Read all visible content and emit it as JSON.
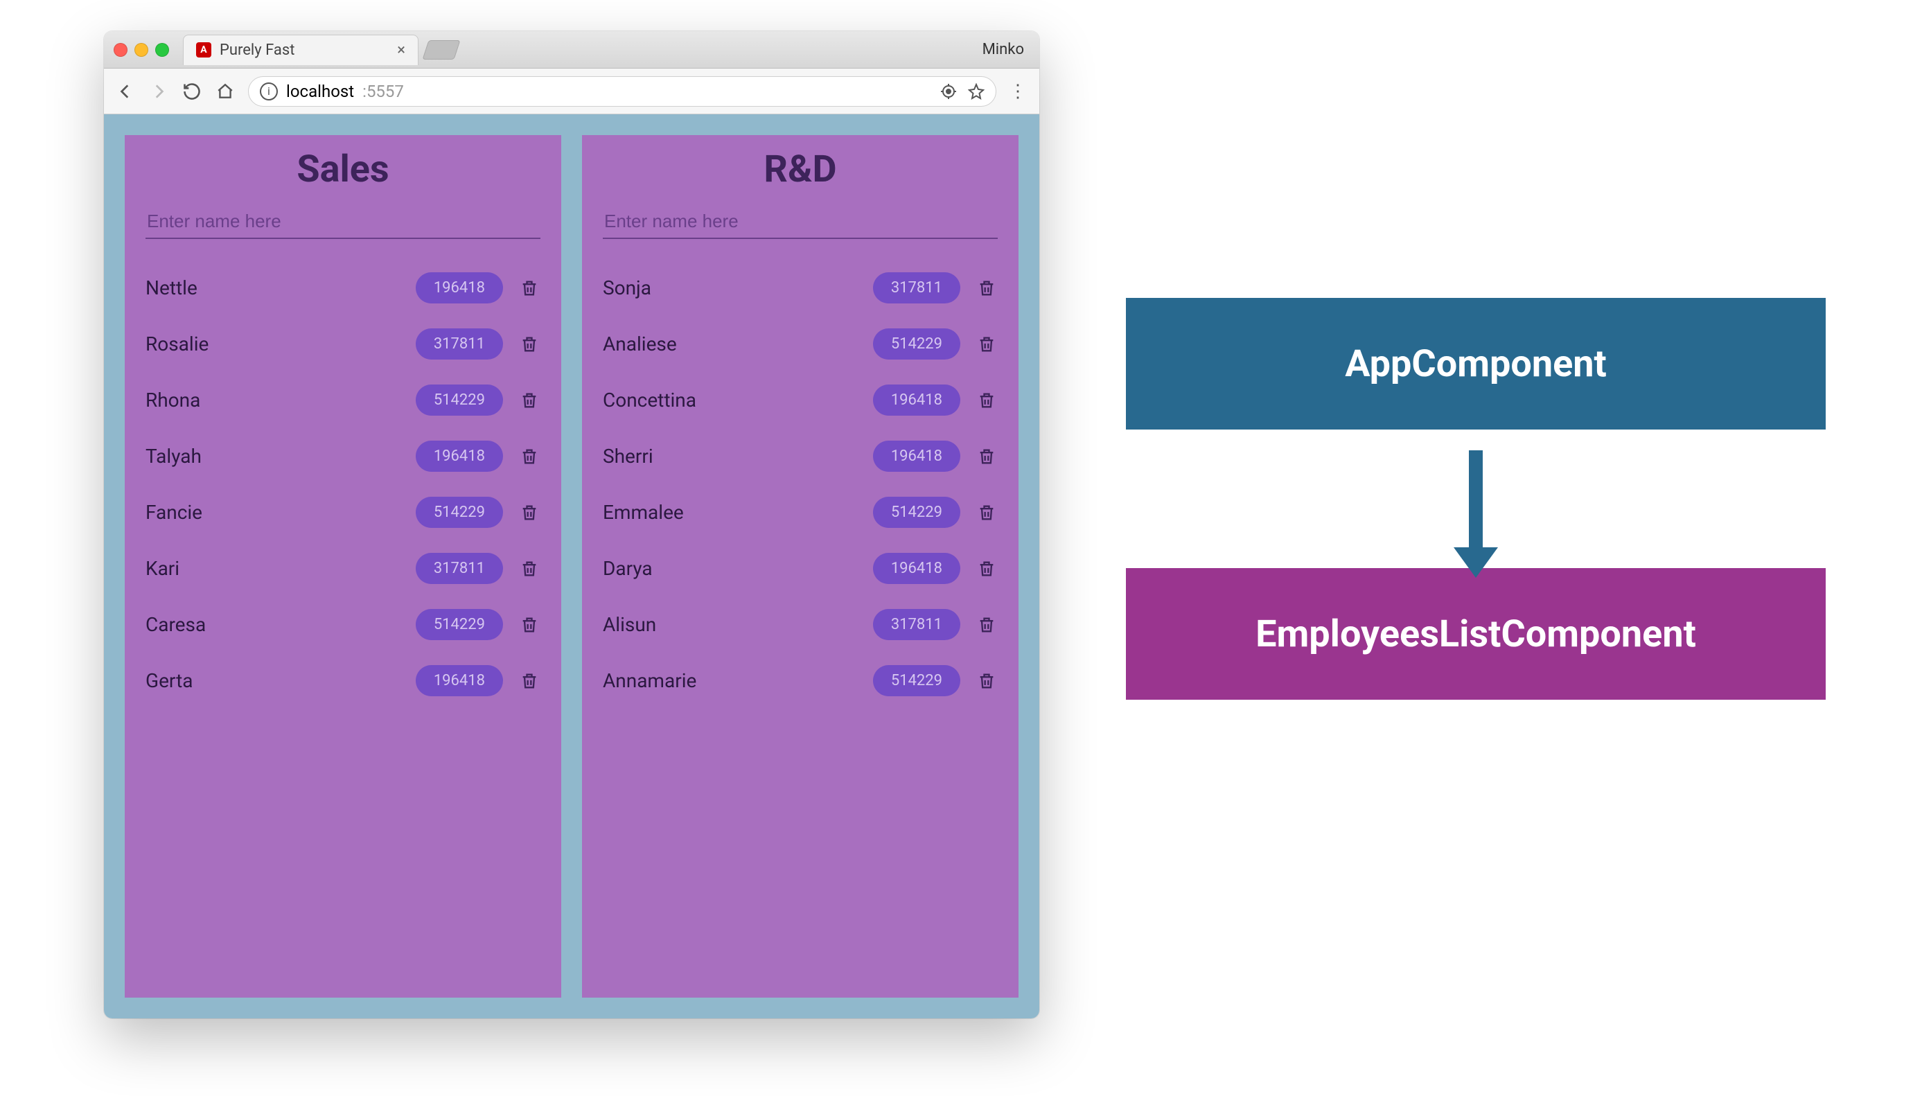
{
  "browser": {
    "tab_title": "Purely Fast",
    "profile_name": "Minko",
    "address_host": "localhost",
    "address_port": ":5557"
  },
  "app": {
    "panels": [
      {
        "title": "Sales",
        "placeholder": "Enter name here",
        "rows": [
          {
            "name": "Nettle",
            "value": "196418"
          },
          {
            "name": "Rosalie",
            "value": "317811"
          },
          {
            "name": "Rhona",
            "value": "514229"
          },
          {
            "name": "Talyah",
            "value": "196418"
          },
          {
            "name": "Fancie",
            "value": "514229"
          },
          {
            "name": "Kari",
            "value": "317811"
          },
          {
            "name": "Caresa",
            "value": "514229"
          },
          {
            "name": "Gerta",
            "value": "196418"
          }
        ]
      },
      {
        "title": "R&D",
        "placeholder": "Enter name here",
        "rows": [
          {
            "name": "Sonja",
            "value": "317811"
          },
          {
            "name": "Analiese",
            "value": "514229"
          },
          {
            "name": "Concettina",
            "value": "196418"
          },
          {
            "name": "Sherri",
            "value": "196418"
          },
          {
            "name": "Emmalee",
            "value": "514229"
          },
          {
            "name": "Darya",
            "value": "196418"
          },
          {
            "name": "Alisun",
            "value": "317811"
          },
          {
            "name": "Annamarie",
            "value": "514229"
          }
        ]
      }
    ]
  },
  "diagram": {
    "nodes": [
      {
        "label": "AppComponent"
      },
      {
        "label": "EmployeesListComponent"
      }
    ]
  }
}
